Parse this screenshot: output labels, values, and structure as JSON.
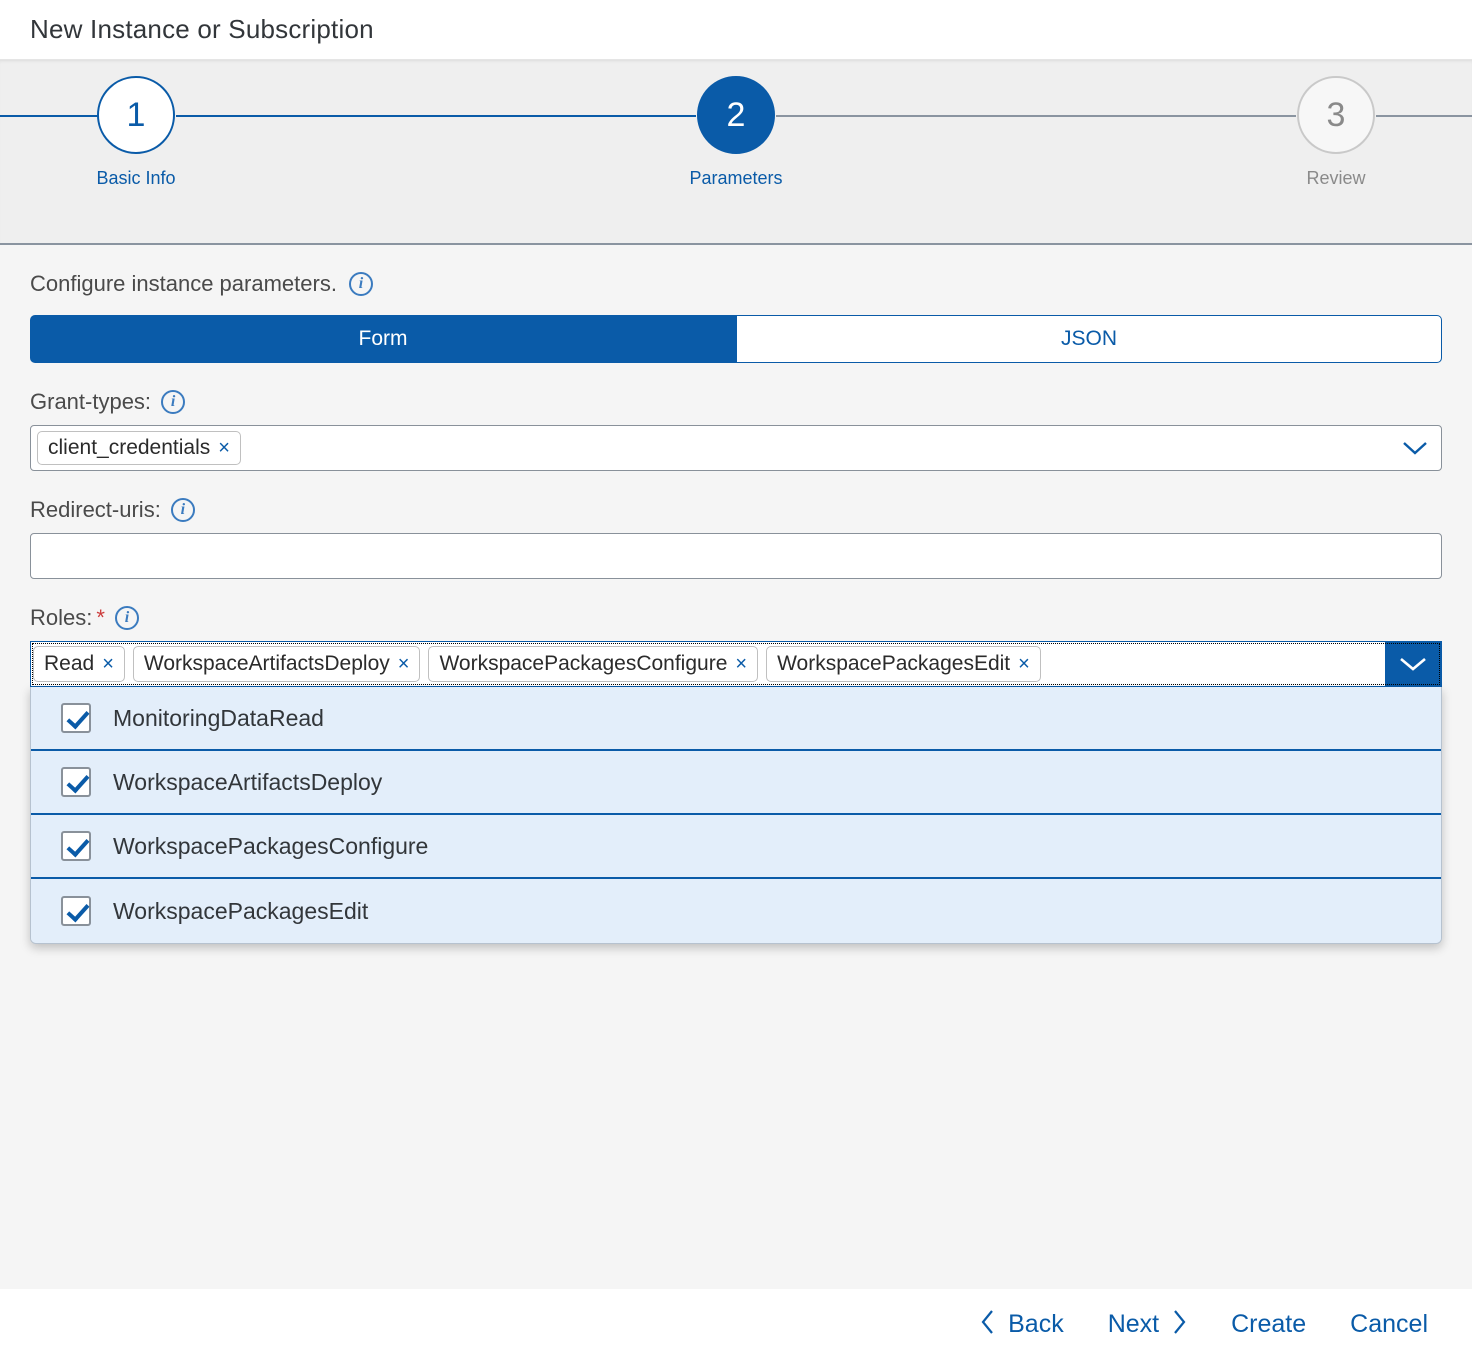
{
  "window": {
    "title": "New Instance or Subscription"
  },
  "wizard": {
    "steps": [
      {
        "number": "1",
        "label": "Basic Info",
        "state": "visited"
      },
      {
        "number": "2",
        "label": "Parameters",
        "state": "active"
      },
      {
        "number": "3",
        "label": "Review",
        "state": "upcoming"
      }
    ]
  },
  "section": {
    "description": "Configure instance parameters.",
    "info_icon": "info-icon",
    "info_glyph": "i"
  },
  "mode_toggle": {
    "options": [
      {
        "label": "Form",
        "selected": true
      },
      {
        "label": "JSON",
        "selected": false
      }
    ]
  },
  "fields": {
    "grant_types": {
      "label": "Grant-types:",
      "tokens": [
        {
          "label": "client_credentials",
          "remove_glyph": "×"
        }
      ],
      "chevron_glyph": "⌄",
      "placeholder": ""
    },
    "redirect_uris": {
      "label": "Redirect-uris:",
      "value": "",
      "placeholder": ""
    },
    "roles": {
      "label": "Roles:",
      "required_marker": "*",
      "tokens": [
        {
          "label": "Read",
          "remove_glyph": "×"
        },
        {
          "label": "WorkspaceArtifactsDeploy",
          "remove_glyph": "×"
        },
        {
          "label": "WorkspacePackagesConfigure",
          "remove_glyph": "×"
        },
        {
          "label": "WorkspacePackagesEdit",
          "remove_glyph": "×"
        }
      ],
      "arrow_glyph": "⌄",
      "dropdown_open": true,
      "options": [
        {
          "label": "MonitoringDataRead",
          "checked": true
        },
        {
          "label": "WorkspaceArtifactsDeploy",
          "checked": true
        },
        {
          "label": "WorkspacePackagesConfigure",
          "checked": true
        },
        {
          "label": "WorkspacePackagesEdit",
          "checked": true
        }
      ]
    }
  },
  "footer": {
    "back": {
      "label": "Back",
      "chevron": "‹"
    },
    "next": {
      "label": "Next",
      "chevron": "›"
    },
    "create": {
      "label": "Create"
    },
    "cancel": {
      "label": "Cancel"
    }
  },
  "colors": {
    "accent": "#0a5ba8",
    "required": "#cc3c3c",
    "dropdown_bg": "#e3eefa",
    "header_bg": "#efefef",
    "content_bg": "#f5f5f5"
  }
}
